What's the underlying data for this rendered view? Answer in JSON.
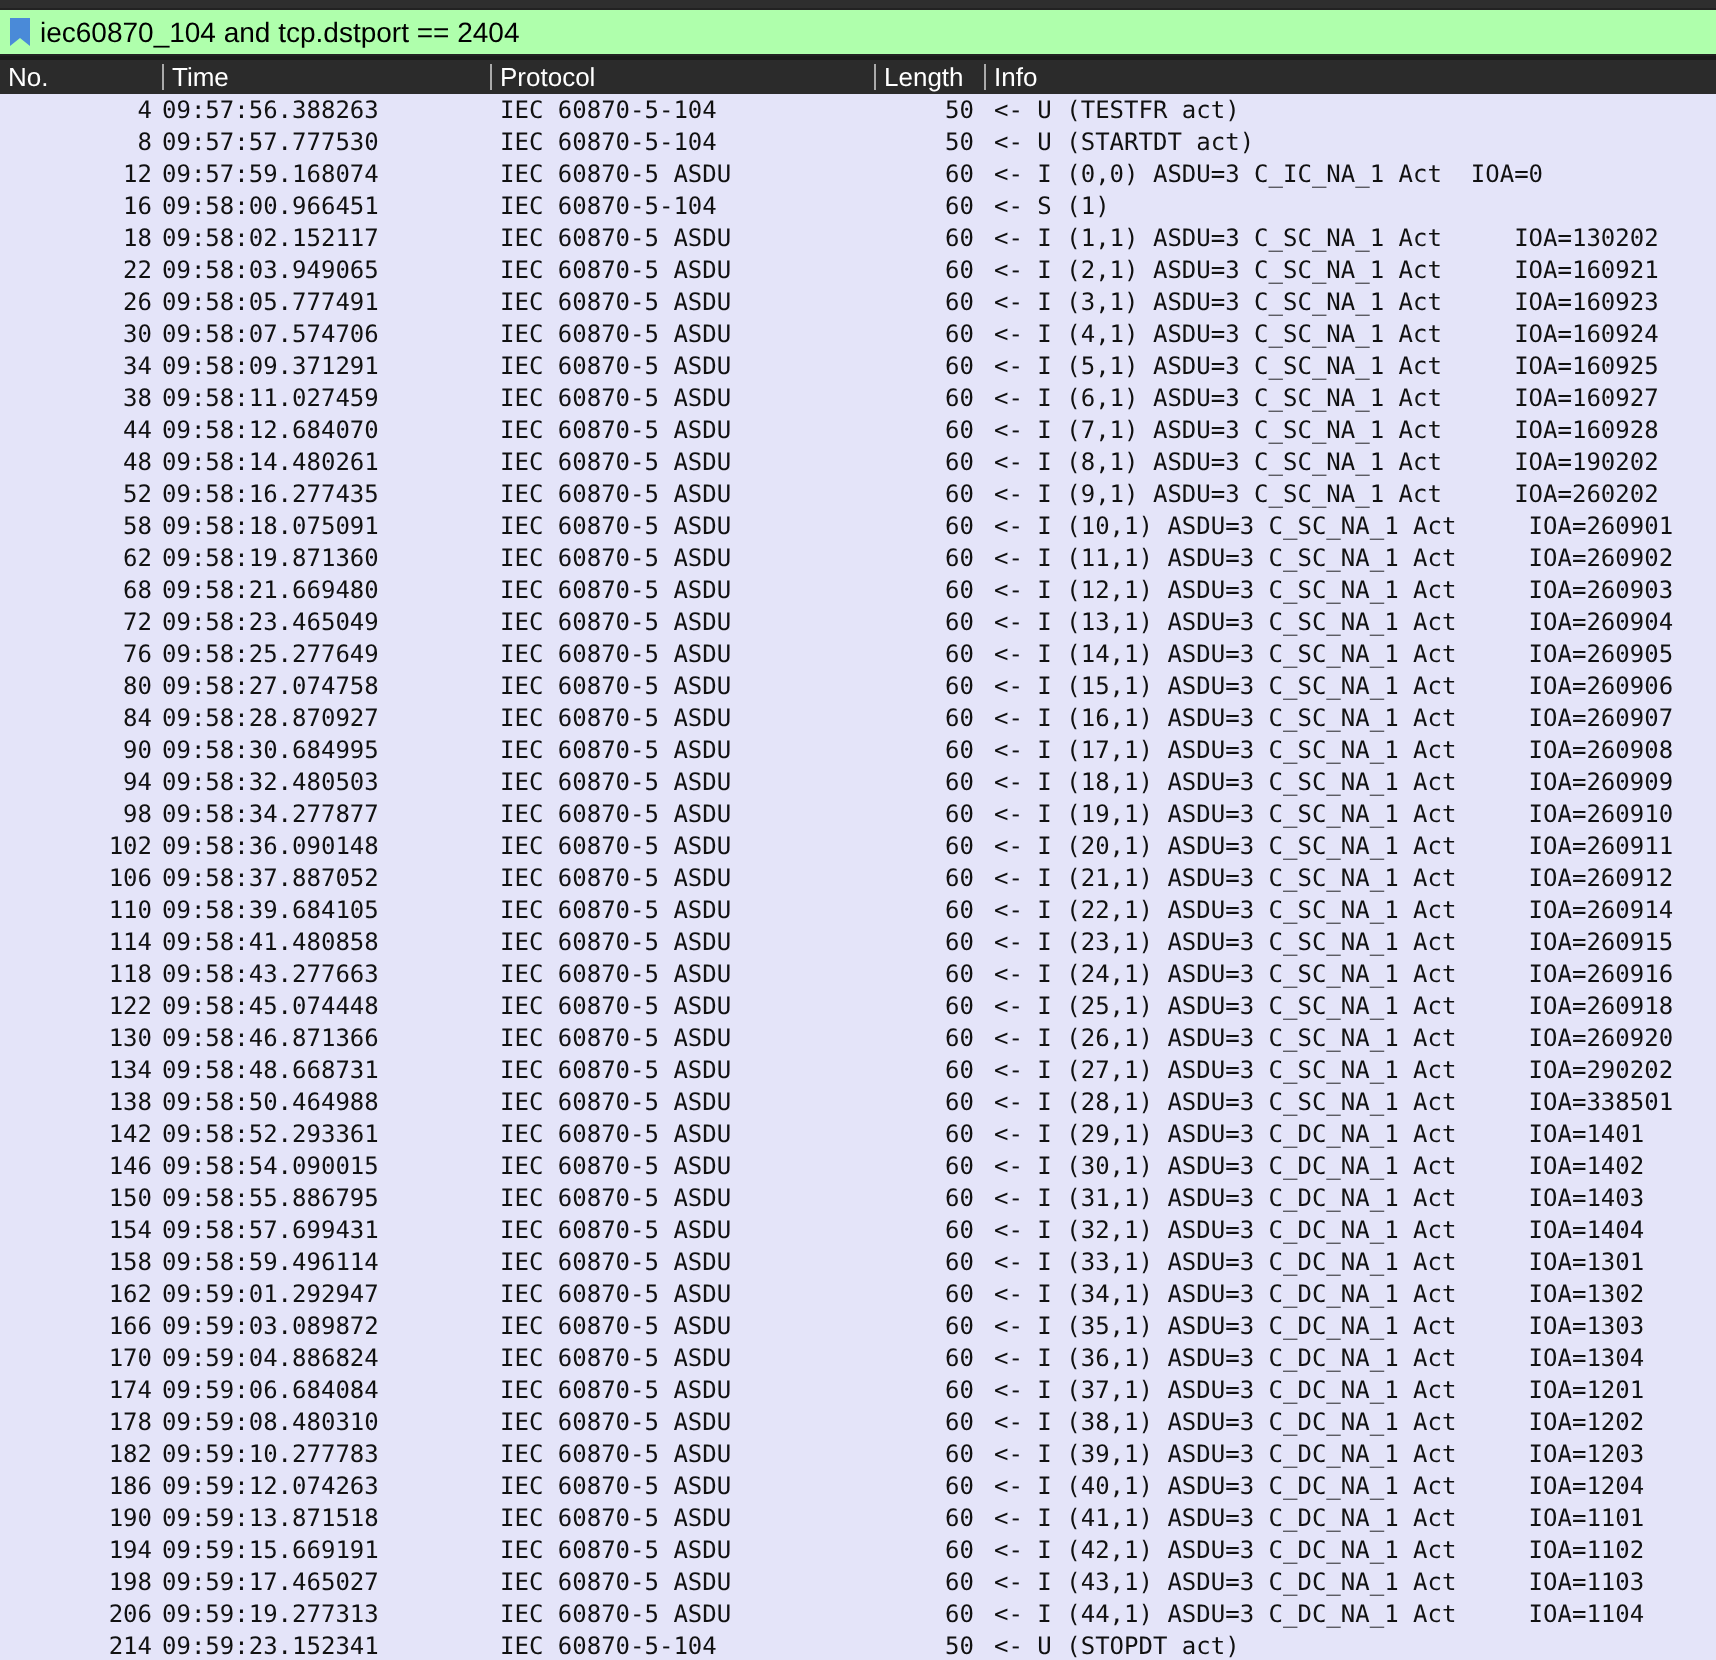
{
  "filter": {
    "value": "iec60870_104 and tcp.dstport == 2404"
  },
  "columns": [
    "No.",
    "Time",
    "Protocol",
    "Length",
    "Info"
  ],
  "rows": [
    [
      "4",
      "09:57:56.388263",
      "IEC 60870-5-104",
      "50",
      "<- U (TESTFR act)"
    ],
    [
      "8",
      "09:57:57.777530",
      "IEC 60870-5-104",
      "50",
      "<- U (STARTDT act)"
    ],
    [
      "12",
      "09:57:59.168074",
      "IEC 60870-5 ASDU",
      "60",
      "<- I (0,0) ASDU=3 C_IC_NA_1 Act  IOA=0"
    ],
    [
      "16",
      "09:58:00.966451",
      "IEC 60870-5-104",
      "60",
      "<- S (1)"
    ],
    [
      "18",
      "09:58:02.152117",
      "IEC 60870-5 ASDU",
      "60",
      "<- I (1,1) ASDU=3 C_SC_NA_1 Act     IOA=130202"
    ],
    [
      "22",
      "09:58:03.949065",
      "IEC 60870-5 ASDU",
      "60",
      "<- I (2,1) ASDU=3 C_SC_NA_1 Act     IOA=160921"
    ],
    [
      "26",
      "09:58:05.777491",
      "IEC 60870-5 ASDU",
      "60",
      "<- I (3,1) ASDU=3 C_SC_NA_1 Act     IOA=160923"
    ],
    [
      "30",
      "09:58:07.574706",
      "IEC 60870-5 ASDU",
      "60",
      "<- I (4,1) ASDU=3 C_SC_NA_1 Act     IOA=160924"
    ],
    [
      "34",
      "09:58:09.371291",
      "IEC 60870-5 ASDU",
      "60",
      "<- I (5,1) ASDU=3 C_SC_NA_1 Act     IOA=160925"
    ],
    [
      "38",
      "09:58:11.027459",
      "IEC 60870-5 ASDU",
      "60",
      "<- I (6,1) ASDU=3 C_SC_NA_1 Act     IOA=160927"
    ],
    [
      "44",
      "09:58:12.684070",
      "IEC 60870-5 ASDU",
      "60",
      "<- I (7,1) ASDU=3 C_SC_NA_1 Act     IOA=160928"
    ],
    [
      "48",
      "09:58:14.480261",
      "IEC 60870-5 ASDU",
      "60",
      "<- I (8,1) ASDU=3 C_SC_NA_1 Act     IOA=190202"
    ],
    [
      "52",
      "09:58:16.277435",
      "IEC 60870-5 ASDU",
      "60",
      "<- I (9,1) ASDU=3 C_SC_NA_1 Act     IOA=260202"
    ],
    [
      "58",
      "09:58:18.075091",
      "IEC 60870-5 ASDU",
      "60",
      "<- I (10,1) ASDU=3 C_SC_NA_1 Act     IOA=260901"
    ],
    [
      "62",
      "09:58:19.871360",
      "IEC 60870-5 ASDU",
      "60",
      "<- I (11,1) ASDU=3 C_SC_NA_1 Act     IOA=260902"
    ],
    [
      "68",
      "09:58:21.669480",
      "IEC 60870-5 ASDU",
      "60",
      "<- I (12,1) ASDU=3 C_SC_NA_1 Act     IOA=260903"
    ],
    [
      "72",
      "09:58:23.465049",
      "IEC 60870-5 ASDU",
      "60",
      "<- I (13,1) ASDU=3 C_SC_NA_1 Act     IOA=260904"
    ],
    [
      "76",
      "09:58:25.277649",
      "IEC 60870-5 ASDU",
      "60",
      "<- I (14,1) ASDU=3 C_SC_NA_1 Act     IOA=260905"
    ],
    [
      "80",
      "09:58:27.074758",
      "IEC 60870-5 ASDU",
      "60",
      "<- I (15,1) ASDU=3 C_SC_NA_1 Act     IOA=260906"
    ],
    [
      "84",
      "09:58:28.870927",
      "IEC 60870-5 ASDU",
      "60",
      "<- I (16,1) ASDU=3 C_SC_NA_1 Act     IOA=260907"
    ],
    [
      "90",
      "09:58:30.684995",
      "IEC 60870-5 ASDU",
      "60",
      "<- I (17,1) ASDU=3 C_SC_NA_1 Act     IOA=260908"
    ],
    [
      "94",
      "09:58:32.480503",
      "IEC 60870-5 ASDU",
      "60",
      "<- I (18,1) ASDU=3 C_SC_NA_1 Act     IOA=260909"
    ],
    [
      "98",
      "09:58:34.277877",
      "IEC 60870-5 ASDU",
      "60",
      "<- I (19,1) ASDU=3 C_SC_NA_1 Act     IOA=260910"
    ],
    [
      "102",
      "09:58:36.090148",
      "IEC 60870-5 ASDU",
      "60",
      "<- I (20,1) ASDU=3 C_SC_NA_1 Act     IOA=260911"
    ],
    [
      "106",
      "09:58:37.887052",
      "IEC 60870-5 ASDU",
      "60",
      "<- I (21,1) ASDU=3 C_SC_NA_1 Act     IOA=260912"
    ],
    [
      "110",
      "09:58:39.684105",
      "IEC 60870-5 ASDU",
      "60",
      "<- I (22,1) ASDU=3 C_SC_NA_1 Act     IOA=260914"
    ],
    [
      "114",
      "09:58:41.480858",
      "IEC 60870-5 ASDU",
      "60",
      "<- I (23,1) ASDU=3 C_SC_NA_1 Act     IOA=260915"
    ],
    [
      "118",
      "09:58:43.277663",
      "IEC 60870-5 ASDU",
      "60",
      "<- I (24,1) ASDU=3 C_SC_NA_1 Act     IOA=260916"
    ],
    [
      "122",
      "09:58:45.074448",
      "IEC 60870-5 ASDU",
      "60",
      "<- I (25,1) ASDU=3 C_SC_NA_1 Act     IOA=260918"
    ],
    [
      "130",
      "09:58:46.871366",
      "IEC 60870-5 ASDU",
      "60",
      "<- I (26,1) ASDU=3 C_SC_NA_1 Act     IOA=260920"
    ],
    [
      "134",
      "09:58:48.668731",
      "IEC 60870-5 ASDU",
      "60",
      "<- I (27,1) ASDU=3 C_SC_NA_1 Act     IOA=290202"
    ],
    [
      "138",
      "09:58:50.464988",
      "IEC 60870-5 ASDU",
      "60",
      "<- I (28,1) ASDU=3 C_SC_NA_1 Act     IOA=338501"
    ],
    [
      "142",
      "09:58:52.293361",
      "IEC 60870-5 ASDU",
      "60",
      "<- I (29,1) ASDU=3 C_DC_NA_1 Act     IOA=1401"
    ],
    [
      "146",
      "09:58:54.090015",
      "IEC 60870-5 ASDU",
      "60",
      "<- I (30,1) ASDU=3 C_DC_NA_1 Act     IOA=1402"
    ],
    [
      "150",
      "09:58:55.886795",
      "IEC 60870-5 ASDU",
      "60",
      "<- I (31,1) ASDU=3 C_DC_NA_1 Act     IOA=1403"
    ],
    [
      "154",
      "09:58:57.699431",
      "IEC 60870-5 ASDU",
      "60",
      "<- I (32,1) ASDU=3 C_DC_NA_1 Act     IOA=1404"
    ],
    [
      "158",
      "09:58:59.496114",
      "IEC 60870-5 ASDU",
      "60",
      "<- I (33,1) ASDU=3 C_DC_NA_1 Act     IOA=1301"
    ],
    [
      "162",
      "09:59:01.292947",
      "IEC 60870-5 ASDU",
      "60",
      "<- I (34,1) ASDU=3 C_DC_NA_1 Act     IOA=1302"
    ],
    [
      "166",
      "09:59:03.089872",
      "IEC 60870-5 ASDU",
      "60",
      "<- I (35,1) ASDU=3 C_DC_NA_1 Act     IOA=1303"
    ],
    [
      "170",
      "09:59:04.886824",
      "IEC 60870-5 ASDU",
      "60",
      "<- I (36,1) ASDU=3 C_DC_NA_1 Act     IOA=1304"
    ],
    [
      "174",
      "09:59:06.684084",
      "IEC 60870-5 ASDU",
      "60",
      "<- I (37,1) ASDU=3 C_DC_NA_1 Act     IOA=1201"
    ],
    [
      "178",
      "09:59:08.480310",
      "IEC 60870-5 ASDU",
      "60",
      "<- I (38,1) ASDU=3 C_DC_NA_1 Act     IOA=1202"
    ],
    [
      "182",
      "09:59:10.277783",
      "IEC 60870-5 ASDU",
      "60",
      "<- I (39,1) ASDU=3 C_DC_NA_1 Act     IOA=1203"
    ],
    [
      "186",
      "09:59:12.074263",
      "IEC 60870-5 ASDU",
      "60",
      "<- I (40,1) ASDU=3 C_DC_NA_1 Act     IOA=1204"
    ],
    [
      "190",
      "09:59:13.871518",
      "IEC 60870-5 ASDU",
      "60",
      "<- I (41,1) ASDU=3 C_DC_NA_1 Act     IOA=1101"
    ],
    [
      "194",
      "09:59:15.669191",
      "IEC 60870-5 ASDU",
      "60",
      "<- I (42,1) ASDU=3 C_DC_NA_1 Act     IOA=1102"
    ],
    [
      "198",
      "09:59:17.465027",
      "IEC 60870-5 ASDU",
      "60",
      "<- I (43,1) ASDU=3 C_DC_NA_1 Act     IOA=1103"
    ],
    [
      "206",
      "09:59:19.277313",
      "IEC 60870-5 ASDU",
      "60",
      "<- I (44,1) ASDU=3 C_DC_NA_1 Act     IOA=1104"
    ],
    [
      "214",
      "09:59:23.152341",
      "IEC 60870-5-104",
      "50",
      "<- U (STOPDT act)"
    ]
  ]
}
